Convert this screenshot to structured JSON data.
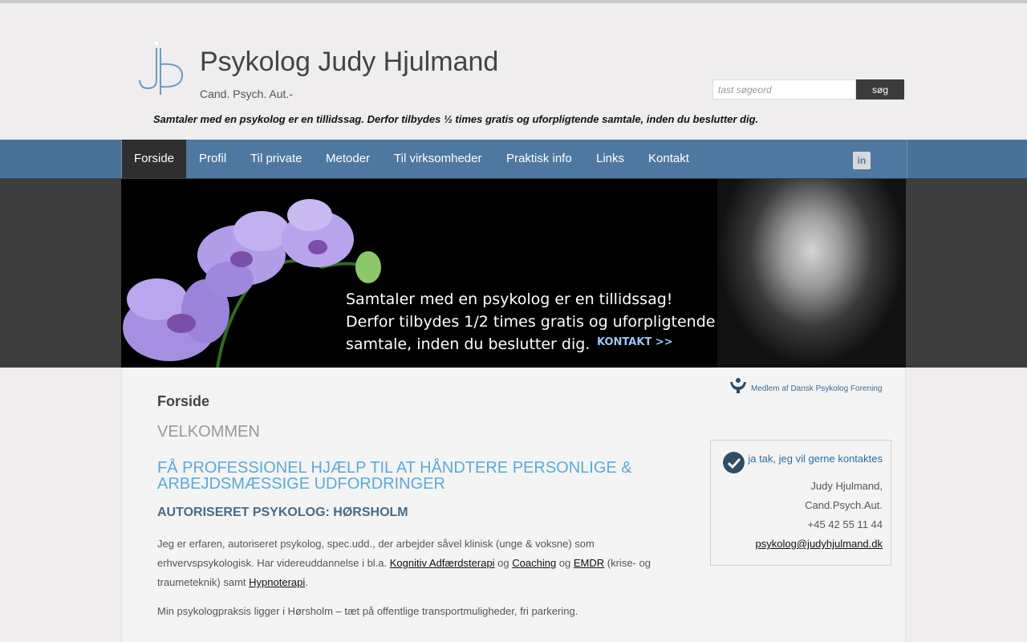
{
  "header": {
    "title": "Psykolog Judy Hjulmand",
    "subtitle": "Cand. Psych. Aut.-",
    "tagline": "Samtaler med en psykolog er en tillidssag. Derfor tilbydes ½ times gratis og uforpligtende samtale, inden du beslutter dig."
  },
  "search": {
    "placeholder": "tast søgeord",
    "button_label": "søg"
  },
  "nav": {
    "items": [
      {
        "label": "Forside",
        "active": true
      },
      {
        "label": "Profil"
      },
      {
        "label": "Til private"
      },
      {
        "label": "Metoder"
      },
      {
        "label": "Til virksomheder"
      },
      {
        "label": "Praktisk info"
      },
      {
        "label": "Links"
      },
      {
        "label": "Kontakt"
      }
    ],
    "social_icon": "linkedin-icon"
  },
  "banner": {
    "line1": "Samtaler med en psykolog er en tillidssag!",
    "line2": "Derfor tilbydes 1/2 times gratis og uforpligtende",
    "line3": "samtale, inden du beslutter dig.",
    "cta": "KONTAKT >>"
  },
  "main": {
    "page_title": "Forside",
    "welcome": "VELKOMMEN",
    "heading": "FÅ PROFESSIONEL HJÆLP TIL AT HÅNDTERE PERSONLIGE & ARBEJDSMÆSSIGE UDFORDRINGER",
    "subheading": "AUTORISERET PSYKOLOG: HØRSHOLM",
    "para1": {
      "text_a": "Jeg er erfaren, autoriseret psykolog, spec.udd., der arbejder såvel klinisk  (unge & voksne) som erhvervspsykologisk. Har videreuddannelse i bl.a. ",
      "link1": "Kognitiv Adfærdsterapi",
      "og1": " og ",
      "link2": "Coaching",
      "og2": " og ",
      "link3": "EMDR",
      "text_b": " (krise- og traumeteknik) samt ",
      "link4": "Hypnoterapi",
      "text_c": "."
    },
    "para2": "Min psykologpraksis ligger i Hørsholm – tæt på offentlige transportmuligheder, fri parkering."
  },
  "sidebar": {
    "member_text": "Medlem af Dansk Psykolog Forening",
    "contact_cta": "ja tak, jeg vil gerne kontaktes",
    "name": "Judy Hjulmand,",
    "title": "Cand.Psych.Aut.",
    "phone": "+45 42 55 11 44",
    "email": "psykolog@judyhjulmand.dk"
  },
  "colors": {
    "nav_bg": "#4f78a0",
    "nav_active": "#2f2f2f",
    "heading_blue": "#5aaad8",
    "subheading": "#466b88"
  }
}
